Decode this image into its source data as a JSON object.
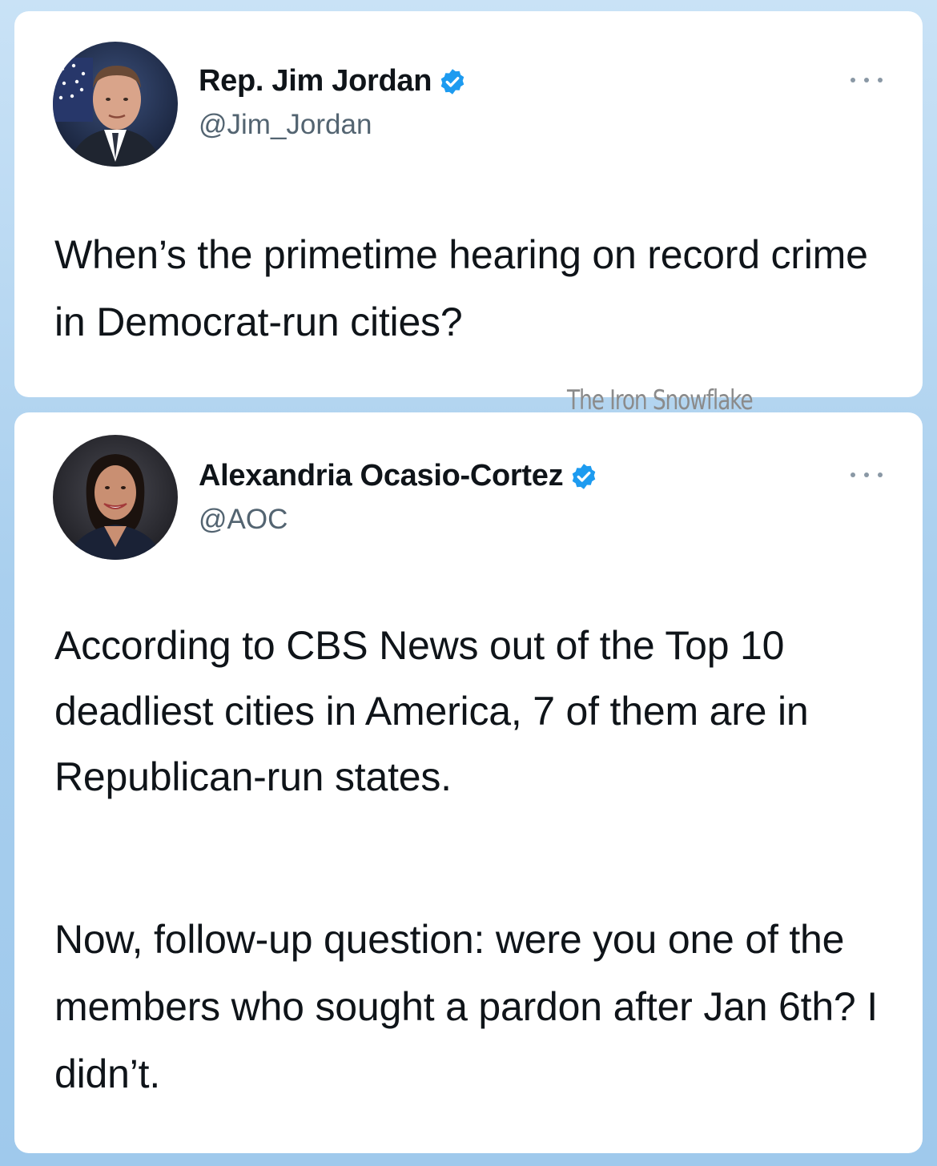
{
  "tweets": [
    {
      "display_name": "Rep. Jim Jordan",
      "handle": "@Jim_Jordan",
      "verified": true,
      "text": "When’s the primetime hearing on record crime in Democrat-run cities?"
    },
    {
      "display_name": "Alexandria Ocasio-Cortez",
      "handle": "@AOC",
      "verified": true,
      "paragraphs": [
        "According to CBS News out of the Top 10 deadliest cities in America, 7 of them are in Republican-run states.",
        "Now, follow-up question: were you one of the members who sought a pardon after Jan 6th? I didn’t."
      ]
    }
  ],
  "watermark": "The Iron Snowflake",
  "icons": {
    "verified": "verified-badge-icon",
    "more": "more-options-icon"
  },
  "colors": {
    "verified_blue": "#1d9bf0",
    "background": "#a9cfee",
    "text": "#0f1419",
    "handle": "#536471"
  }
}
